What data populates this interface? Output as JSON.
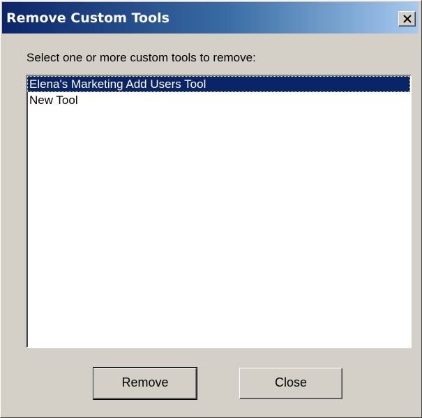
{
  "window": {
    "title": "Remove Custom Tools"
  },
  "icons": {
    "close": "close-icon"
  },
  "prompt": "Select one or more custom tools to remove:",
  "tools": [
    {
      "label": "Elena's Marketing Add Users Tool",
      "selected": true
    },
    {
      "label": "New Tool",
      "selected": false
    }
  ],
  "buttons": {
    "remove": "Remove",
    "close": "Close"
  },
  "colors": {
    "title_bar_start": "#0a246a",
    "title_bar_end": "#a6caf0",
    "selection": "#0a246a",
    "dialog_face": "#d4d0c8"
  }
}
